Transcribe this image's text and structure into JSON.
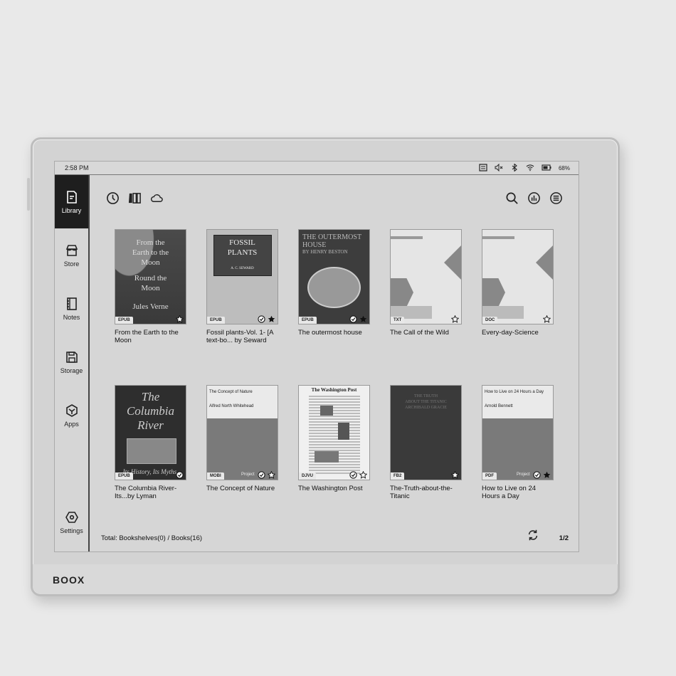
{
  "device": {
    "brand": "BOOX"
  },
  "status_bar": {
    "time": "2:58 PM",
    "battery": "68%",
    "icons": [
      "sync-icon",
      "mute-icon",
      "bluetooth-icon",
      "wifi-icon",
      "battery-icon"
    ]
  },
  "sidebar": {
    "items": [
      {
        "label": "Library",
        "icon": "library-icon",
        "active": true
      },
      {
        "label": "Store",
        "icon": "store-icon"
      },
      {
        "label": "Notes",
        "icon": "notes-icon"
      },
      {
        "label": "Storage",
        "icon": "storage-icon"
      },
      {
        "label": "Apps",
        "icon": "apps-icon"
      },
      {
        "label": "Settings",
        "icon": "settings-icon"
      }
    ]
  },
  "toolbar": {
    "left_icons": [
      "recent-clock-icon",
      "bookshelf-icon",
      "cloud-icon"
    ],
    "right_icons": [
      "search-icon",
      "statistics-icon",
      "menu-icon"
    ]
  },
  "books": [
    {
      "title": "From the Earth to the Moon",
      "format": "EPUB",
      "cover_lines": [
        "From the",
        "Earth to the",
        "Moon",
        "Round the",
        "Moon",
        "Jules Verne"
      ],
      "read": false,
      "starred": "outline-filled"
    },
    {
      "title": "Fossil plants-Vol. 1- [A text-bo... by Seward",
      "format": "EPUB",
      "cover_lines": [
        "FOSSIL",
        "PLANTS",
        "A. C. SEWARD"
      ],
      "read": true,
      "starred": "filled"
    },
    {
      "title": "The outermost house",
      "format": "EPUB",
      "cover_lines": [
        "THE OUTERMOST",
        "HOUSE",
        "BY HENRY BESTON"
      ],
      "read": true,
      "starred": "filled"
    },
    {
      "title": "The Call of the Wild",
      "format": "TXT",
      "cover_lines": [],
      "read": false,
      "starred": "outline"
    },
    {
      "title": "Every-day-Science",
      "format": "DOC",
      "cover_lines": [],
      "read": false,
      "starred": "outline"
    },
    {
      "title": "The Columbia River-Its...by Lyman",
      "format": "EPUB",
      "cover_lines": [
        "The",
        "Columbia",
        "River",
        "Its History, Its Myths,"
      ],
      "read": true,
      "starred": "none"
    },
    {
      "title": "The Concept of Nature",
      "format": "MOBI",
      "cover_lines": [
        "The Concept of Nature",
        "Alfred North Whitehead",
        "Project"
      ],
      "read": true,
      "starred": "outline"
    },
    {
      "title": "The Washington Post",
      "format": "DJVU",
      "cover_lines": [
        "The Washington Post"
      ],
      "read": true,
      "starred": "outline"
    },
    {
      "title": "The-Truth-about-the-Titanic",
      "format": "FB2",
      "cover_lines": [
        "THE TRUTH",
        "ABOUT THE TITANIC",
        "ARCHIBALD GRACIE"
      ],
      "read": false,
      "starred": "outline-filled"
    },
    {
      "title": "How to Live on 24 Hours a Day",
      "format": "PDF",
      "cover_lines": [
        "How to Live on 24 Hours a Day",
        "Arnold Bennett",
        "Project"
      ],
      "read": true,
      "starred": "filled"
    }
  ],
  "footer": {
    "total": "Total: Bookshelves(0) / Books(16)",
    "page": "1/2"
  }
}
